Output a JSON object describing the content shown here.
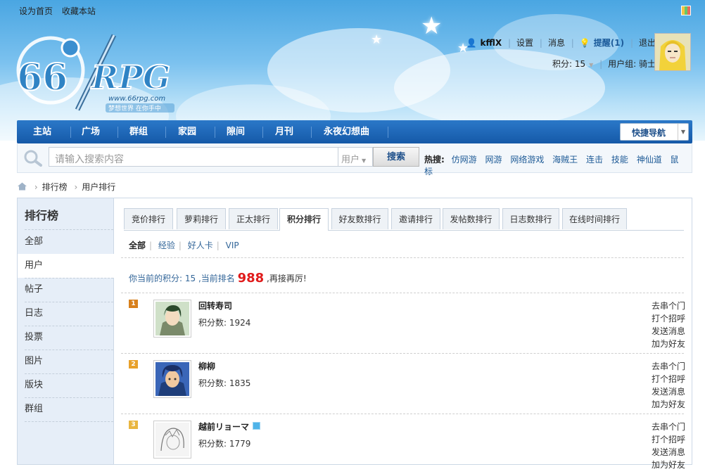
{
  "topbar": {
    "set_home": "设为首页",
    "bookmark": "收藏本站"
  },
  "logo": {
    "text_rpg": "RPG",
    "text_66": "66",
    "url_text": "www.66rpg.com",
    "slogan": "梦想世界 在你手中"
  },
  "user": {
    "name": "kfflX",
    "settings": "设置",
    "messages": "消息",
    "remind": "提醒(1)",
    "logout": "退出",
    "points_label": "积分: 15",
    "group_label": "用户组: 骑士"
  },
  "nav": {
    "items": [
      "主站",
      "广场",
      "群组",
      "家园",
      "隙间",
      "月刊",
      "永夜幻想曲"
    ],
    "quick_nav": "快捷导航"
  },
  "search": {
    "placeholder": "请输入搜索内容",
    "type": "用户",
    "button": "搜索",
    "hot_label": "热搜:",
    "hot_items": [
      "仿网游",
      "网游",
      "网络游戏",
      "海贼王",
      "连击",
      "技能",
      "神仙道",
      "鼠标"
    ]
  },
  "breadcrumb": {
    "items": [
      "排行榜",
      "用户排行"
    ]
  },
  "sidebar": {
    "title": "排行榜",
    "items": [
      "全部",
      "用户",
      "帖子",
      "日志",
      "投票",
      "图片",
      "版块",
      "群组"
    ],
    "active": "用户"
  },
  "tabs": [
    "竞价排行",
    "萝莉排行",
    "正太排行",
    "积分排行",
    "好友数排行",
    "邀请排行",
    "发帖数排行",
    "日志数排行",
    "在线时间排行"
  ],
  "active_tab": "积分排行",
  "subtabs": [
    "全部",
    "经验",
    "好人卡",
    "VIP"
  ],
  "my_rank": {
    "prefix": "你当前的积分: 15 ,当前排名",
    "rank": "988",
    "suffix": ",再接再厉!"
  },
  "ranking": [
    {
      "rank": "1",
      "name": "回转寿司",
      "score": "积分数: 1924",
      "color": "#d8801c"
    },
    {
      "rank": "2",
      "name": "柳柳",
      "score": "积分数: 1835",
      "color": "#e8a12a"
    },
    {
      "rank": "3",
      "name": "越前リョーマ",
      "score": "积分数: 1779",
      "color": "#e9b640"
    }
  ],
  "actions": [
    "去串个门",
    "打个招呼",
    "发送消息",
    "加为好友"
  ]
}
